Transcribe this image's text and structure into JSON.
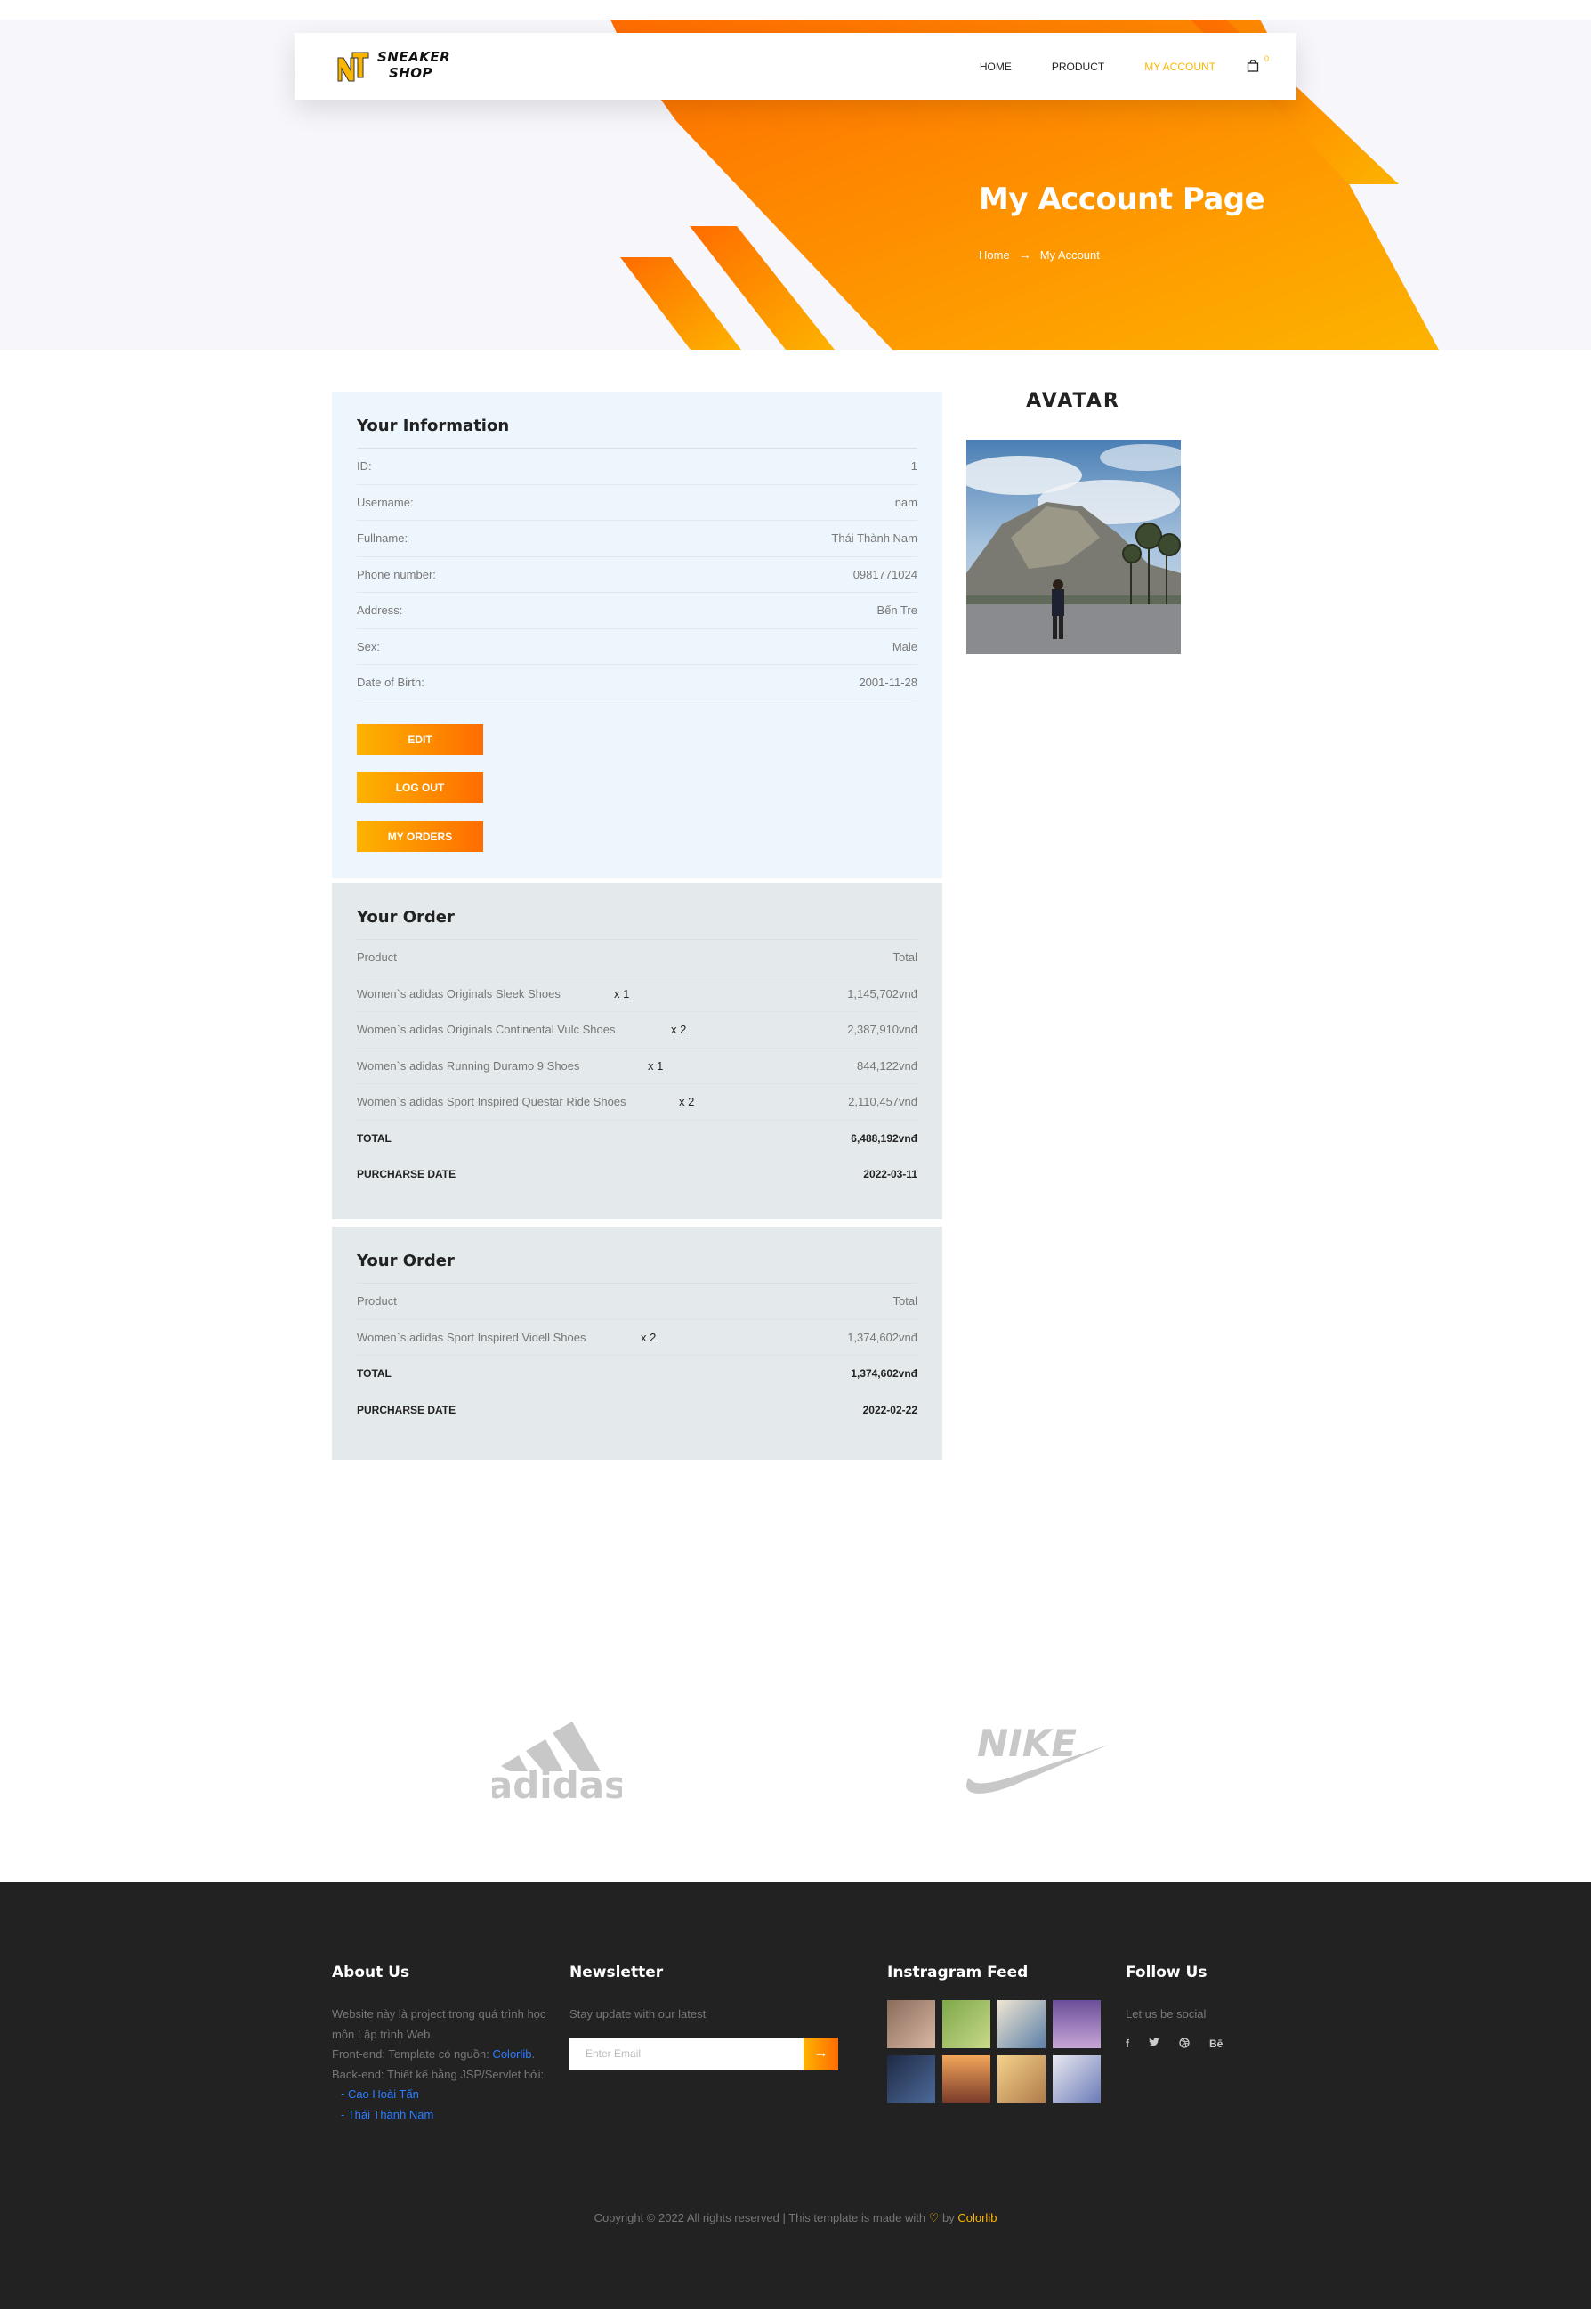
{
  "brand": {
    "logo_text_line1": "SNEAKER",
    "logo_text_line2": "SHOP",
    "logo_mark": "NT"
  },
  "nav": {
    "items": [
      {
        "label": "Home"
      },
      {
        "label": "Product"
      },
      {
        "label": "My Account"
      }
    ],
    "cart_count": "0"
  },
  "banner": {
    "title": "My Account Page",
    "breadcrumb_home": "Home",
    "breadcrumb_current": "My Account"
  },
  "info": {
    "title": "Your Information",
    "rows": [
      {
        "label": "ID:",
        "value": "1"
      },
      {
        "label": "Username:",
        "value": "nam"
      },
      {
        "label": "Fullname:",
        "value": "Thái Thành Nam"
      },
      {
        "label": "Phone number:",
        "value": "0981771024"
      },
      {
        "label": "Address:",
        "value": "Bến Tre"
      },
      {
        "label": "Sex:",
        "value": "Male"
      },
      {
        "label": "Date of Birth:",
        "value": "2001-11-28"
      }
    ],
    "buttons": {
      "edit": "EDIT",
      "logout": "LOG OUT",
      "orders": "MY ORDERS"
    }
  },
  "orders": [
    {
      "title": "Your Order",
      "header": {
        "product": "Product",
        "total": "Total"
      },
      "items": [
        {
          "name": "Women`s adidas Originals Sleek Shoes",
          "qty": "x 1",
          "total": "1,145,702vnđ"
        },
        {
          "name": "Women`s adidas Originals Continental Vulc Shoes",
          "qty": "x 2",
          "total": "2,387,910vnđ"
        },
        {
          "name": "Women`s adidas Running Duramo 9 Shoes",
          "qty": "x 1",
          "total": "844,122vnđ"
        },
        {
          "name": "Women`s adidas Sport Inspired Questar Ride Shoes",
          "qty": "x 2",
          "total": "2,110,457vnđ"
        }
      ],
      "total_label": "TOTAL",
      "total_value": "6,488,192vnđ",
      "date_label": "PURCHARSE DATE",
      "date_value": "2022-03-11"
    },
    {
      "title": "Your Order",
      "header": {
        "product": "Product",
        "total": "Total"
      },
      "items": [
        {
          "name": "Women`s adidas Sport Inspired Videll Shoes",
          "qty": "x 2",
          "total": "1,374,602vnđ"
        }
      ],
      "total_label": "TOTAL",
      "total_value": "1,374,602vnđ",
      "date_label": "PURCHARSE DATE",
      "date_value": "2022-02-22"
    }
  ],
  "avatar": {
    "title": "AVATAR"
  },
  "brands": {
    "adidas": "adidas",
    "nike": "NIKE"
  },
  "footer": {
    "about": {
      "title": "About Us",
      "line1": "Website này là project trong quá trình học môn Lập trình Web.",
      "line2_prefix": "Front-end: Template có nguồn: ",
      "line2_link": "Colorlib",
      "line2_suffix": ".",
      "line3": "Back-end: Thiết kế bằng JSP/Servlet bởi:",
      "author1": "- Cao Hoài Tấn",
      "author2": "- Thái Thành Nam"
    },
    "newsletter": {
      "title": "Newsletter",
      "text": "Stay update with our latest",
      "placeholder": "Enter Email"
    },
    "instagram": {
      "title": "Instragram Feed"
    },
    "follow": {
      "title": "Follow Us",
      "text": "Let us be social",
      "icons": [
        "f",
        "t",
        "d",
        "Bē"
      ]
    },
    "copyright": {
      "prefix": "Copyright © 2022 All rights reserved | This template is made with ",
      "by": " by ",
      "link": "Colorlib"
    }
  },
  "colors": {
    "accent": "#f8b600",
    "accent_dark": "#ff6c00",
    "footer_bg": "#222222"
  }
}
